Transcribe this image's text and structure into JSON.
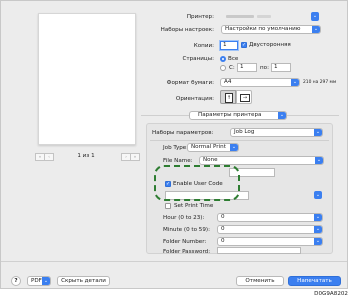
{
  "printer": {
    "label": "Принтер:",
    "value": ""
  },
  "presets": {
    "label": "Наборы настроек:",
    "value": "Настройки по умолчанию"
  },
  "copies": {
    "label": "Копии:",
    "value": "1",
    "duplex_label": "Двусторонняя"
  },
  "pages": {
    "label": "Страницы:",
    "all_label": "Все",
    "from_label": "С:",
    "from_value": "1",
    "to_label": "по:",
    "to_value": "1"
  },
  "paper_size": {
    "label": "Формат бумаги:",
    "value": "A4",
    "dimensions": "210 на 297 мм"
  },
  "orientation": {
    "label": "Ориентация:"
  },
  "section_popup": {
    "value": "Параметры принтера"
  },
  "feature_sets": {
    "label": "Наборы параметров:",
    "value": "Job Log"
  },
  "job_type": {
    "label": "Job Type:",
    "value": "Normal Print"
  },
  "file_name": {
    "label": "File Name:",
    "value": "None"
  },
  "enable_user_code": {
    "label": "Enable User Code"
  },
  "set_print_time": {
    "label": "Set Print Time"
  },
  "hour": {
    "label": "Hour (0 to 23):",
    "value": "0"
  },
  "minute": {
    "label": "Minute (0 to 59):",
    "value": "0"
  },
  "folder_number": {
    "label": "Folder Number:",
    "value": "0"
  },
  "folder_password": {
    "label": "Folder Password:",
    "value": ""
  },
  "preview": {
    "page_indicator": "1 из 1"
  },
  "footer": {
    "help": "?",
    "pdf": "PDF",
    "hide_details": "Скрыть детали",
    "cancel": "Отменить",
    "print": "Напечатать"
  },
  "figure_code": "D0G9A8202",
  "accent_color": "#3b7ff0",
  "highlight_color": "#2e7d32"
}
